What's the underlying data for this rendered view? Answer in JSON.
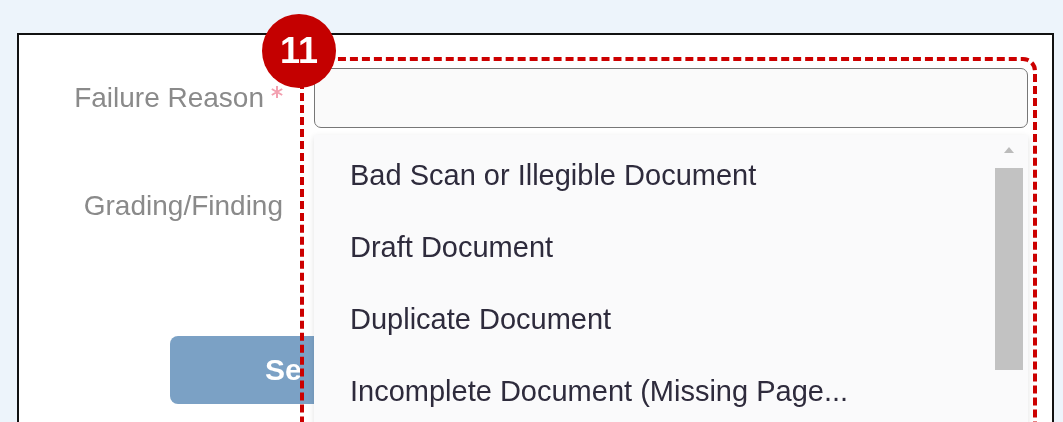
{
  "callout": {
    "number": "11"
  },
  "form": {
    "fields": [
      {
        "label": "Failure Reason",
        "required": true
      },
      {
        "label": "Grading/Finding",
        "required": false
      }
    ],
    "dropdown": {
      "options": [
        {
          "label": "Bad Scan or Illegible Document"
        },
        {
          "label": "Draft Document"
        },
        {
          "label": "Duplicate Document"
        },
        {
          "label": "Incomplete Document (Missing Page..."
        }
      ]
    },
    "button": {
      "label": "Se"
    }
  }
}
